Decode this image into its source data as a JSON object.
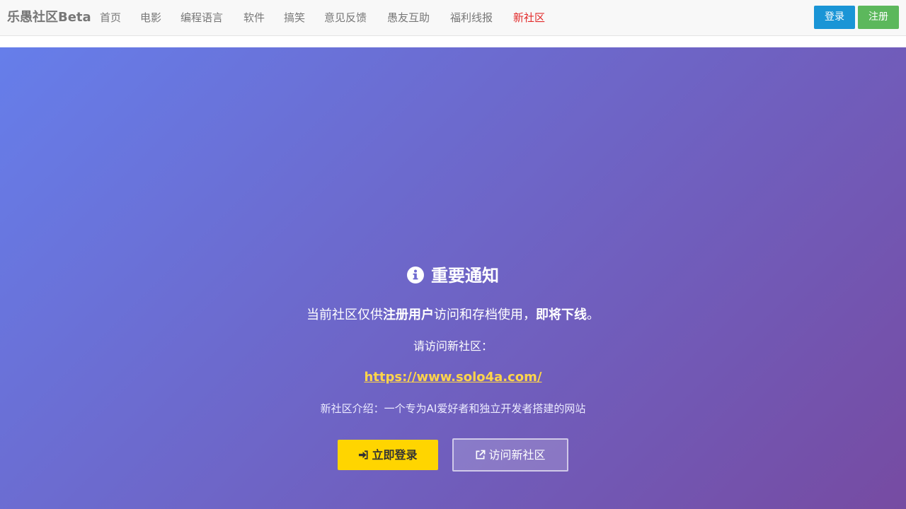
{
  "navbar": {
    "brand": "乐愚社区Beta",
    "items": [
      {
        "label": "首页"
      },
      {
        "label": "电影"
      },
      {
        "label": "编程语言"
      },
      {
        "label": "软件"
      },
      {
        "label": "搞笑"
      },
      {
        "label": "意见反馈"
      },
      {
        "label": "愚友互助"
      },
      {
        "label": "福利线报"
      },
      {
        "label": "新社区"
      }
    ],
    "login_label": "登录",
    "register_label": "注册"
  },
  "notice": {
    "title": "重要通知",
    "line1_a": "当前社区仅供",
    "line1_bold_a": "注册用户",
    "line1_b": "访问和存档使用，",
    "line1_bold_b": "即将下线",
    "line1_c": "。",
    "visit_text": "请访问新社区：",
    "url": "https://www.solo4a.com/",
    "intro": "新社区介绍：一个专为AI爱好者和独立开发者搭建的网站",
    "login_now_label": "立即登录",
    "visit_new_label": "访问新社区"
  },
  "icons": {
    "title_icon": "info-circle-icon",
    "login_icon": "sign-in-icon",
    "external_icon": "external-link-icon"
  },
  "colors": {
    "nav_highlight": "#e22a2a",
    "login_button": "#1a95d6",
    "register_button": "#5cb85c",
    "url_link": "#ffd54a",
    "primary_action": "#ffd500",
    "gradient_start": "#667eea",
    "gradient_end": "#764ba2"
  }
}
